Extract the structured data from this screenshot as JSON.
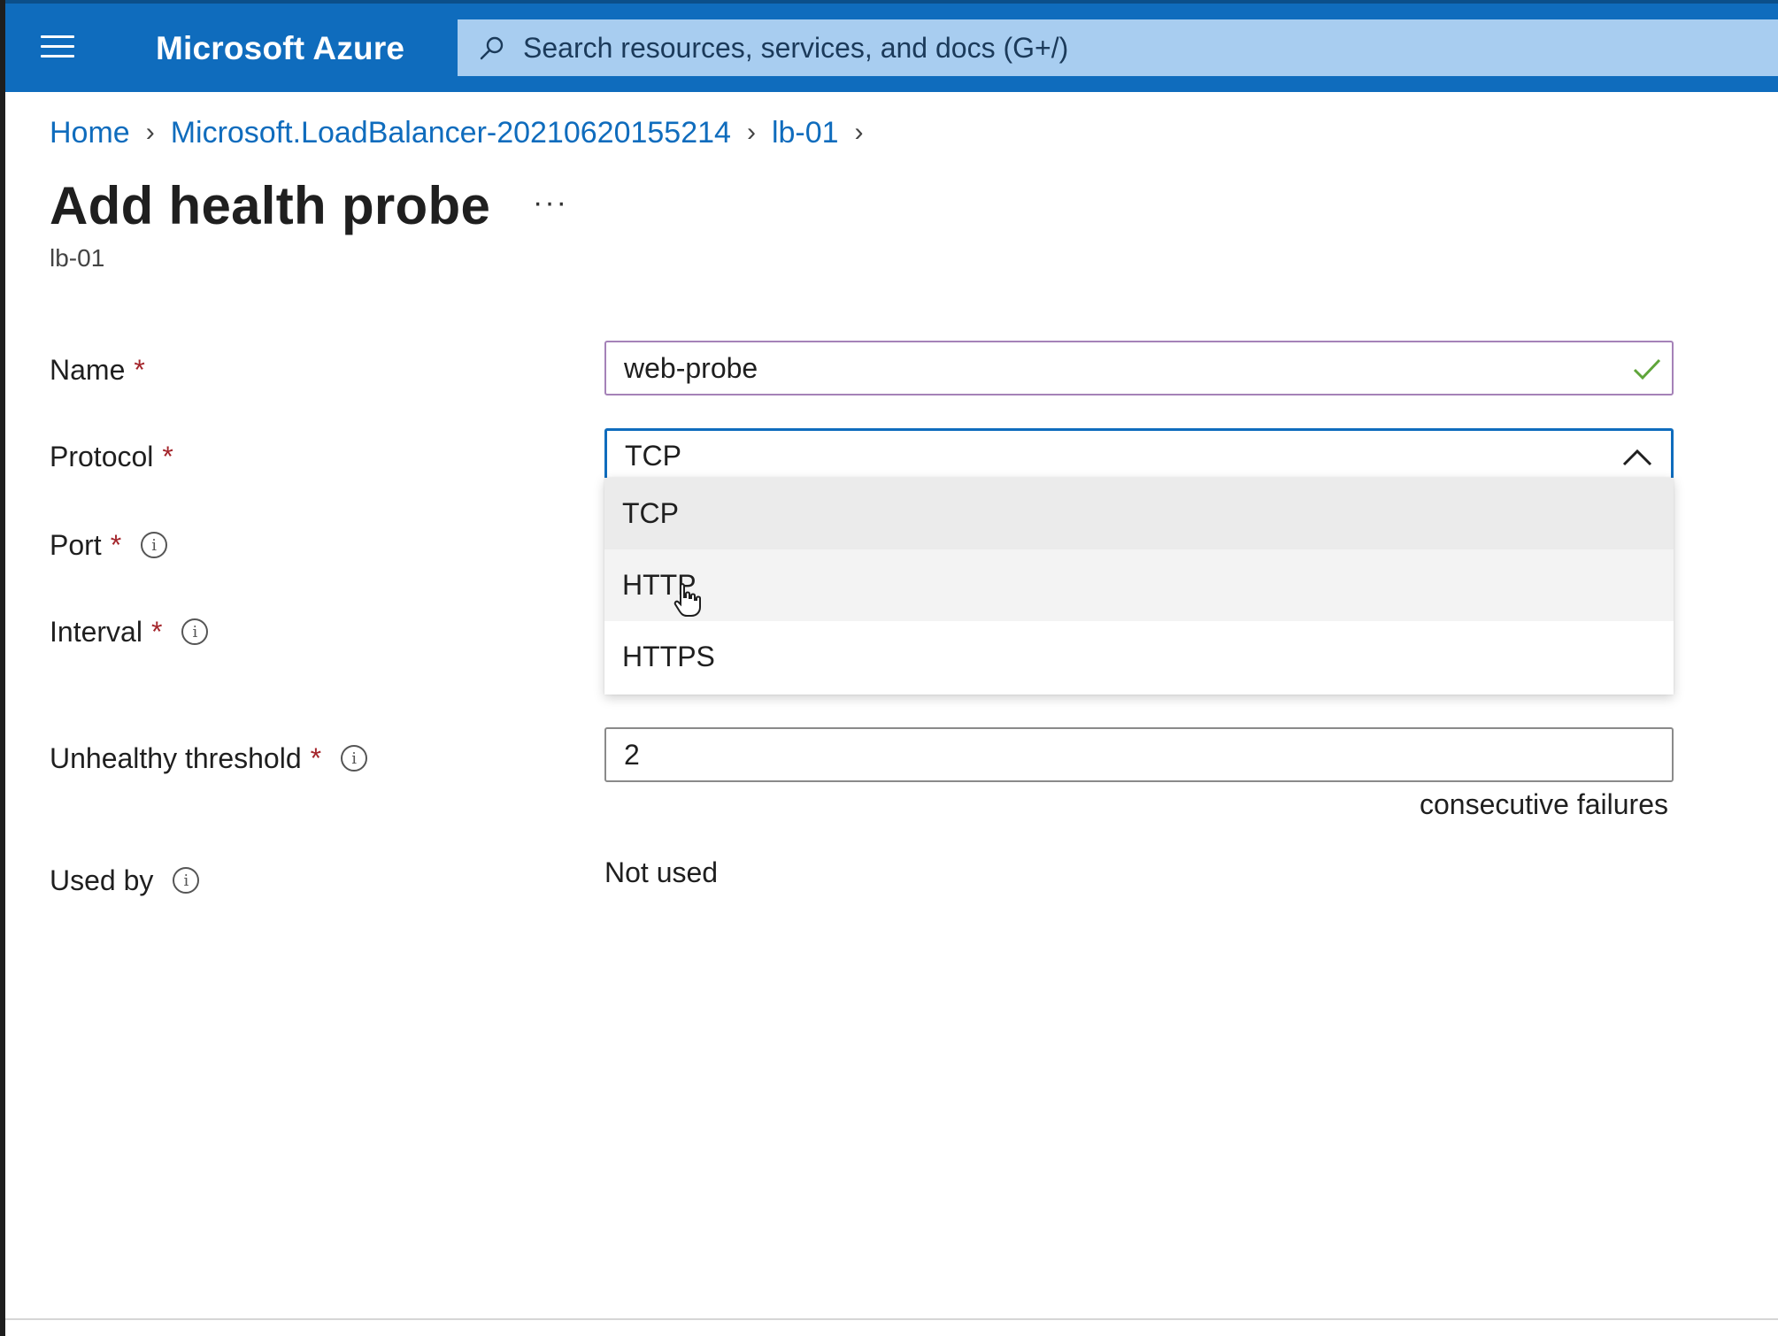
{
  "topbar": {
    "brand": "Microsoft Azure",
    "search_placeholder": "Search resources, services, and docs (G+/)"
  },
  "breadcrumb": [
    "Home",
    "Microsoft.LoadBalancer-20210620155214",
    "lb-01"
  ],
  "page": {
    "title": "Add health probe",
    "more": "···",
    "subtitle": "lb-01"
  },
  "form": {
    "name_label": "Name",
    "name_value": "web-probe",
    "protocol_label": "Protocol",
    "protocol_value": "TCP",
    "protocol_options": [
      "TCP",
      "HTTP",
      "HTTPS"
    ],
    "port_label": "Port",
    "interval_label": "Interval",
    "unhealthy_label": "Unhealthy threshold",
    "unhealthy_value": "2",
    "unhealthy_hint": "consecutive failures",
    "used_by_label": "Used by",
    "used_by_value": "Not used",
    "required_mark": "*",
    "info_glyph": "i"
  },
  "colors": {
    "accent": "#0f6cbd",
    "search_bg": "#a8cdf0",
    "valid_check": "#5fa53a",
    "required": "#a4262c"
  }
}
